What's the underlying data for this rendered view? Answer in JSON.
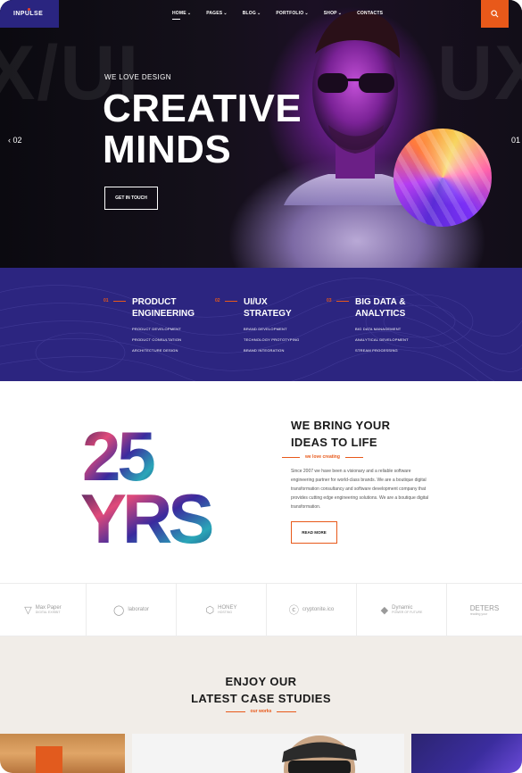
{
  "nav": {
    "logo": "INPULSE",
    "menu": [
      {
        "label": "HOME",
        "chevron": true,
        "active": true
      },
      {
        "label": "PAGES",
        "chevron": true,
        "active": false
      },
      {
        "label": "BLOG",
        "chevron": true,
        "active": false
      },
      {
        "label": "PORTFOLIO",
        "chevron": true,
        "active": false
      },
      {
        "label": "SHOP",
        "chevron": true,
        "active": false
      },
      {
        "label": "CONTACTS",
        "chevron": false,
        "active": false
      }
    ],
    "search_icon": "search-icon"
  },
  "hero": {
    "ghost_left": "X/UI",
    "ghost_right": "UX",
    "eyebrow": "WE LOVE DESIGN",
    "title_line1": "CREATIVE",
    "title_line2": "MINDS",
    "cta": "GET IN TOUCH",
    "prev": "02",
    "next": "01"
  },
  "services": [
    {
      "num": "01",
      "title": "PRODUCT ENGINEERING",
      "items": [
        "PRODUCT DEVELOPMENT",
        "PRODUCT CONSULTATION",
        "ARCHITECTURE DESIGN"
      ]
    },
    {
      "num": "02",
      "title": "UI/UX STRATEGY",
      "items": [
        "BRAND DEVELOPMENT",
        "TECHNOLOGY PROTOTYPING",
        "BRAND INTEGRATION"
      ]
    },
    {
      "num": "03",
      "title": "BIG DATA & ANALYTICS",
      "items": [
        "BIG DATA MANAGEMENT",
        "ANALYTICAL DEVELOPMENT",
        "STREAM PROCESSING"
      ]
    }
  ],
  "about": {
    "years_number": "25",
    "years_text": "YRS",
    "heading_line1": "WE BRING YOUR",
    "heading_line2": "IDEAS TO LIFE",
    "sub": "we love creating",
    "paragraph": "Since 2007 we have been a visionary and a reliable software engineering partner for world-class brands. We are a boutique digital transformation consultancy and software development company that provides cutting edge engineering solutions. We are a boutique digital transformation.",
    "button": "READ MORE"
  },
  "clients": [
    {
      "name": "Max Paper",
      "sub": "DIGITAL EXHIBIT",
      "icon": "m-logo-icon"
    },
    {
      "name": "laborator",
      "sub": "",
      "icon": "v-logo-icon"
    },
    {
      "name": "HONEY",
      "sub": "HOSTING",
      "icon": "hex-logo-icon"
    },
    {
      "name": "cryptonite.ico",
      "sub": "",
      "icon": "c-logo-icon"
    },
    {
      "name": "Dynamic",
      "sub": "POWER OF FUTURE",
      "icon": "d-logo-icon"
    },
    {
      "name": "DETERS",
      "sub": "reading your",
      "icon": ""
    }
  ],
  "cases": {
    "heading_line1": "ENJOY OUR",
    "heading_line2": "LATEST CASE STUDIES",
    "sub": "our works"
  },
  "colors": {
    "accent": "#e8591a",
    "brand": "#2c2580",
    "dark": "#1a1a1a"
  }
}
